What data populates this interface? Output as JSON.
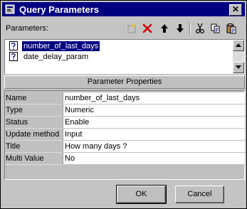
{
  "window": {
    "title": "Query Parameters",
    "close_glyph": "✕"
  },
  "parameters": {
    "label": "Parameters:",
    "items": [
      {
        "name": "number_of_last_days",
        "icon": "parameter-icon",
        "selected": true
      },
      {
        "name": "date_delay_param",
        "icon": "parameter-icon",
        "selected": false
      }
    ]
  },
  "toolbar": {
    "icons": [
      "new-icon",
      "delete-icon",
      "move-up-icon",
      "move-down-icon",
      "cut-icon",
      "copy-icon",
      "paste-icon"
    ]
  },
  "properties": {
    "header": "Parameter Properties",
    "rows": [
      {
        "name": "Name",
        "value": "number_of_last_days"
      },
      {
        "name": "Type",
        "value": "Numeric"
      },
      {
        "name": "Status",
        "value": "Enable"
      },
      {
        "name": "Update method",
        "value": "Input"
      },
      {
        "name": "Title",
        "value": "How many days ?"
      },
      {
        "name": "Multi Value",
        "value": "No"
      }
    ]
  },
  "buttons": {
    "ok": "OK",
    "cancel": "Cancel"
  },
  "colors": {
    "titlebar": "#000080",
    "selection": "#000080",
    "delete_red": "#cc0000"
  }
}
